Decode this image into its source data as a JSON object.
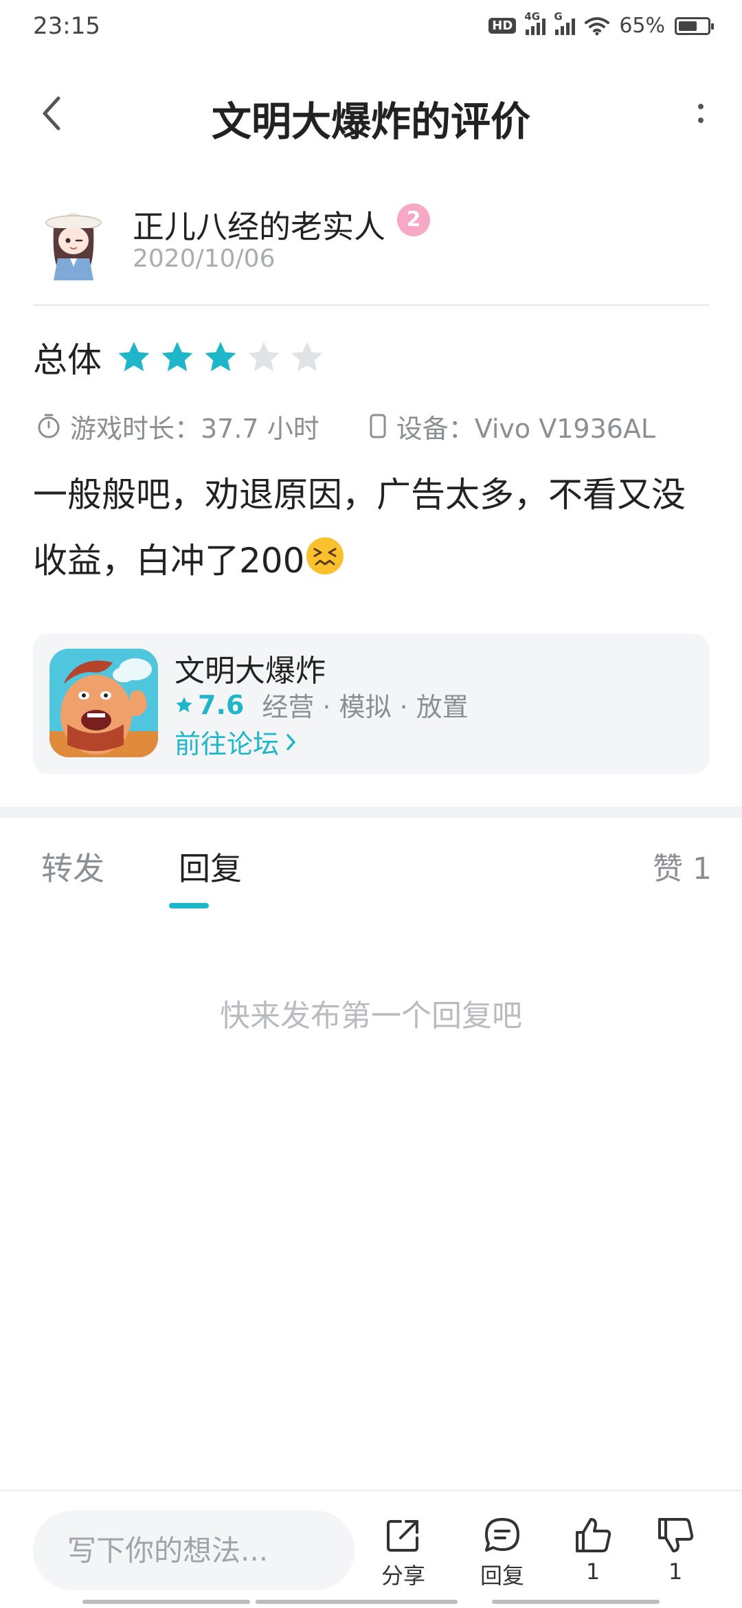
{
  "status_bar": {
    "time": "23:15",
    "hd_label": "HD",
    "net1": "4G",
    "net2": "G",
    "battery": "65%",
    "battery_level": 0.65
  },
  "header": {
    "title": "文明大爆炸的评价"
  },
  "review": {
    "author": "正儿八经的老实人",
    "level": "2",
    "date": "2020/10/06",
    "rating_label": "总体",
    "rating": 3,
    "rating_max": 5,
    "playtime": "游戏时长：37.7 小时",
    "device": "设备：Vivo V1936AL",
    "text": "一般般吧，劝退原因，广告太多，不看又没收益，白冲了200"
  },
  "game": {
    "name": "文明大爆炸",
    "score": "7.6",
    "tags": "经营 · 模拟 · 放置",
    "forum_link": "前往论坛"
  },
  "tabs": {
    "repost": "转发",
    "reply": "回复",
    "likes": "赞 1"
  },
  "empty_state": "快来发布第一个回复吧",
  "bottom_bar": {
    "placeholder": "写下你的想法...",
    "share": "分享",
    "reply": "回复",
    "like_count": "1",
    "dislike_count": "1"
  },
  "colors": {
    "accent": "#1fb6c9",
    "star_off": "#dfe3e6",
    "level_badge": "#f7a8c4"
  }
}
